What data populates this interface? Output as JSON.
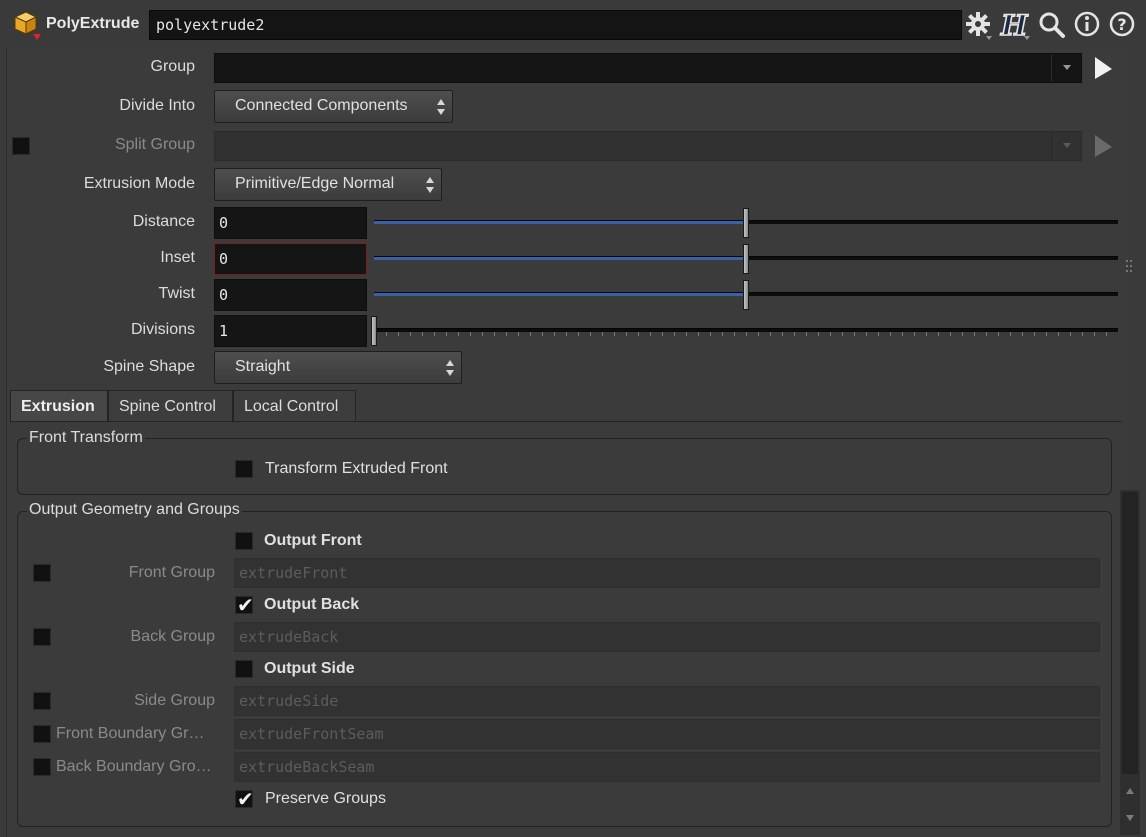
{
  "header": {
    "node_type": "PolyExtrude",
    "node_name": "polyextrude2",
    "icons": [
      "gear-icon",
      "houdini-help-icon",
      "search-icon",
      "info-icon",
      "help-icon"
    ]
  },
  "params": {
    "group": {
      "label": "Group",
      "value": ""
    },
    "divide_into": {
      "label": "Divide Into",
      "value": "Connected Components"
    },
    "split_group": {
      "label": "Split Group",
      "value": ""
    },
    "extrusion_mode": {
      "label": "Extrusion Mode",
      "value": "Primitive/Edge Normal"
    },
    "distance": {
      "label": "Distance",
      "value": "0",
      "slider_fraction": 0.5
    },
    "inset": {
      "label": "Inset",
      "value": "0",
      "slider_fraction": 0.5
    },
    "twist": {
      "label": "Twist",
      "value": "0",
      "slider_fraction": 0.5
    },
    "divisions": {
      "label": "Divisions",
      "value": "1",
      "slider_fraction": 0.0
    },
    "spine_shape": {
      "label": "Spine Shape",
      "value": "Straight"
    }
  },
  "tabs": [
    "Extrusion",
    "Spine Control",
    "Local Control"
  ],
  "active_tab": "Extrusion",
  "front_transform": {
    "title": "Front Transform",
    "transform_extruded_front": {
      "label": "Transform Extruded Front",
      "checked": false
    }
  },
  "output_geometry": {
    "title": "Output Geometry and Groups",
    "output_front": {
      "label": "Output Front",
      "checked": false
    },
    "front_group": {
      "label": "Front Group",
      "placeholder": "extrudeFront"
    },
    "output_back": {
      "label": "Output Back",
      "checked": true
    },
    "back_group": {
      "label": "Back Group",
      "placeholder": "extrudeBack"
    },
    "output_side": {
      "label": "Output Side",
      "checked": false
    },
    "side_group": {
      "label": "Side Group",
      "placeholder": "extrudeSide"
    },
    "front_boundary_group": {
      "label": "Front Boundary Gr…",
      "placeholder": "extrudeFrontSeam"
    },
    "back_boundary_group": {
      "label": "Back Boundary Gro…",
      "placeholder": "extrudeBackSeam"
    },
    "preserve_groups": {
      "label": "Preserve Groups",
      "checked": true
    }
  },
  "colors": {
    "slider_fill": "#3762a8",
    "inset_focus_border": "#7a1d1d",
    "node_icon": "#e9b23a"
  }
}
